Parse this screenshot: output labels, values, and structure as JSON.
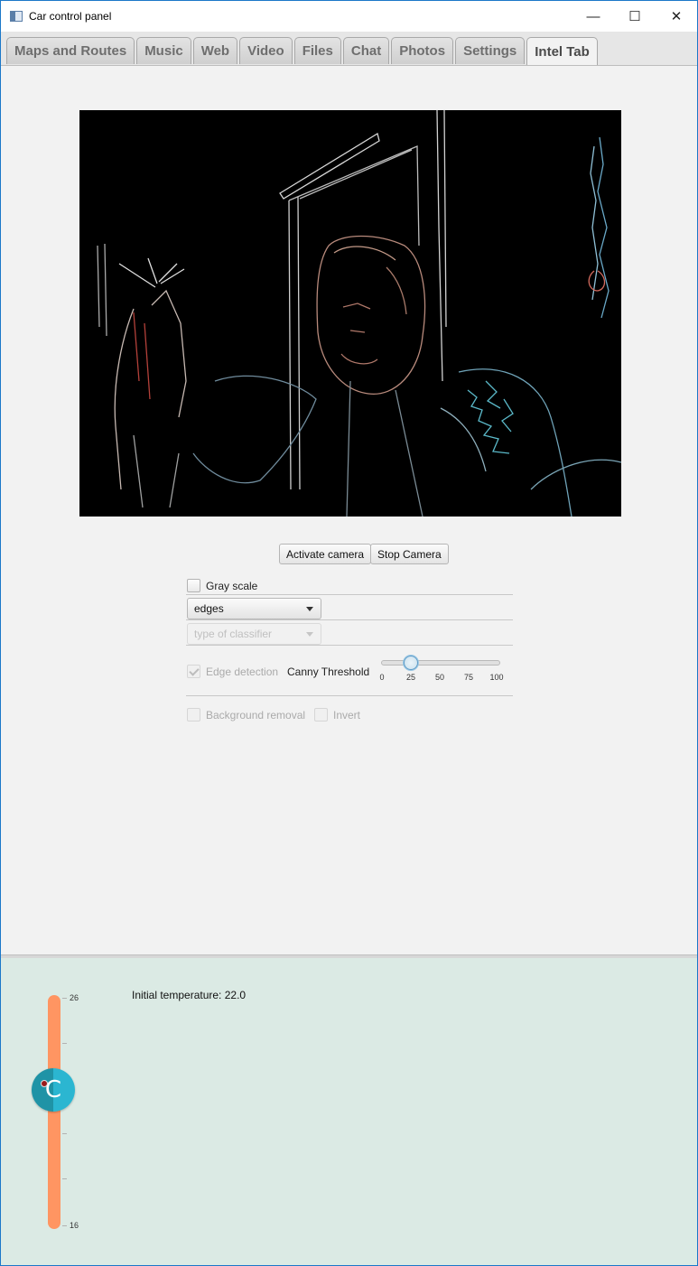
{
  "window": {
    "title": "Car control panel",
    "controls": {
      "minimize": "—",
      "maximize": "☐",
      "close": "✕"
    }
  },
  "tabs": [
    {
      "label": "Maps and Routes"
    },
    {
      "label": "Music"
    },
    {
      "label": "Web"
    },
    {
      "label": "Video"
    },
    {
      "label": "Files"
    },
    {
      "label": "Chat"
    },
    {
      "label": "Photos"
    },
    {
      "label": "Settings"
    },
    {
      "label": "Intel Tab",
      "active": true
    }
  ],
  "camera": {
    "buttons": {
      "activate": "Activate camera",
      "stop": "Stop Camera"
    }
  },
  "filters": {
    "gray_scale": {
      "label": "Gray scale",
      "checked": false
    },
    "mode_select": {
      "value": "edges"
    },
    "classifier_select": {
      "placeholder": "type of classifier",
      "disabled": true
    },
    "edge_detection": {
      "label": "Edge detection",
      "checked": true,
      "disabled": true
    },
    "canny_threshold": {
      "label": "Canny Threshold",
      "value": 25,
      "min": 0,
      "max": 100,
      "ticks": [
        "0",
        "25",
        "50",
        "75",
        "100"
      ]
    },
    "background_removal": {
      "label": "Background removal",
      "checked": false,
      "disabled": true
    },
    "invert": {
      "label": "Invert",
      "checked": false,
      "disabled": true
    }
  },
  "temperature": {
    "max_label": "26",
    "min_label": "16",
    "text": "Initial temperature: 22.0",
    "value": 22.0,
    "knob_glyph": "C"
  },
  "colors": {
    "accent": "#2bb6d1",
    "slider_track": "#ff9562",
    "bottom_bg": "#dbeae4"
  }
}
